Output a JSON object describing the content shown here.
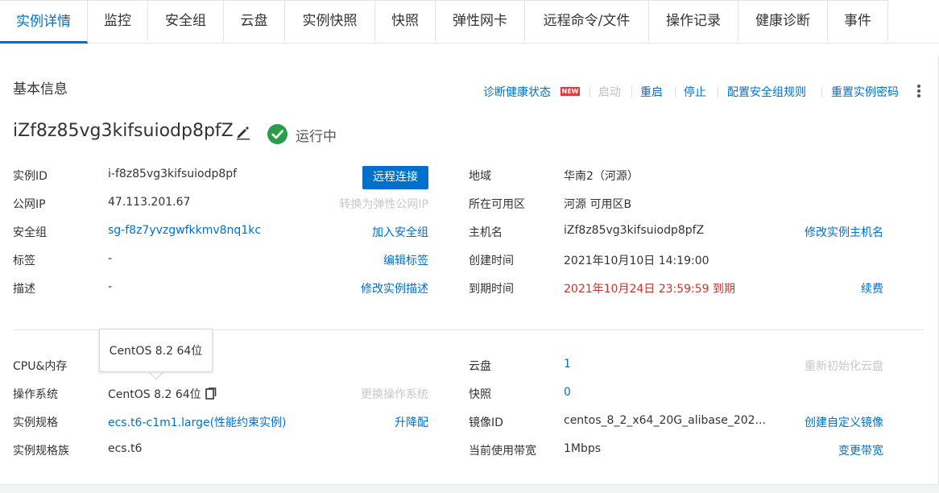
{
  "tabs": [
    {
      "label": "实例详情",
      "active": true
    },
    {
      "label": "监控"
    },
    {
      "label": "安全组"
    },
    {
      "label": "云盘"
    },
    {
      "label": "实例快照"
    },
    {
      "label": "快照"
    },
    {
      "label": "弹性网卡"
    },
    {
      "label": "远程命令/文件"
    },
    {
      "label": "操作记录"
    },
    {
      "label": "健康诊断"
    },
    {
      "label": "事件"
    }
  ],
  "basic": {
    "title": "基本信息",
    "actions": {
      "diagnose": "诊断健康状态",
      "new_badge": "NEW",
      "start": "启动",
      "restart": "重启",
      "stop": "停止",
      "config_sg": "配置安全组规则",
      "reset_pwd": "重置实例密码"
    },
    "instance_name": "iZf8z85vg3kifsuiodp8pfZ",
    "status": "运行中",
    "colors": {
      "accent": "#0070cc",
      "status_green": "#2a9d4a",
      "expire_red": "#d0342c"
    }
  },
  "left_rows": [
    {
      "label": "实例ID",
      "value": "i-f8z85vg3kifsuiodp8pf",
      "action": ""
    },
    {
      "label": "公网IP",
      "value": "47.113.201.67",
      "action": "转换为弹性公网IP"
    },
    {
      "label": "安全组",
      "value": "sg-f8z7yvzgwfkkmv8nq1kc",
      "action": "加入安全组"
    },
    {
      "label": "标签",
      "value": "-",
      "action": "编辑标签"
    },
    {
      "label": "描述",
      "value": "-",
      "action": "修改实例描述"
    }
  ],
  "connect_button": "远程连接",
  "right_rows": [
    {
      "label": "地域",
      "value": "华南2（河源）",
      "action": ""
    },
    {
      "label": "所在可用区",
      "value": "河源 可用区B",
      "action": ""
    },
    {
      "label": "主机名",
      "value": "iZf8z85vg3kifsuiodp8pfZ",
      "action": "修改实例主机名"
    },
    {
      "label": "创建时间",
      "value": "2021年10月10日 14:19:00",
      "action": ""
    },
    {
      "label": "到期时间",
      "value": "2021年10月24日 23:59:59 到期",
      "action": "续费"
    }
  ],
  "tooltip": "CentOS 8.2 64位",
  "left_rows2": [
    {
      "label": "CPU&内存",
      "value": "",
      "action": ""
    },
    {
      "label": "操作系统",
      "value": "CentOS 8.2 64位",
      "action": "更换操作系统"
    },
    {
      "label": "实例规格",
      "value": "ecs.t6-c1m1.large(性能约束实例)",
      "action": "升降配"
    },
    {
      "label": "实例规格族",
      "value": "ecs.t6",
      "action": ""
    }
  ],
  "right_rows2": [
    {
      "label": "云盘",
      "value": "1",
      "action": "重新初始化云盘"
    },
    {
      "label": "快照",
      "value": "0",
      "action": ""
    },
    {
      "label": "镜像ID",
      "value": "centos_8_2_x64_20G_alibase_202...",
      "action": "创建自定义镜像"
    },
    {
      "label": "当前使用带宽",
      "value": "1Mbps",
      "action": "变更带宽"
    }
  ]
}
